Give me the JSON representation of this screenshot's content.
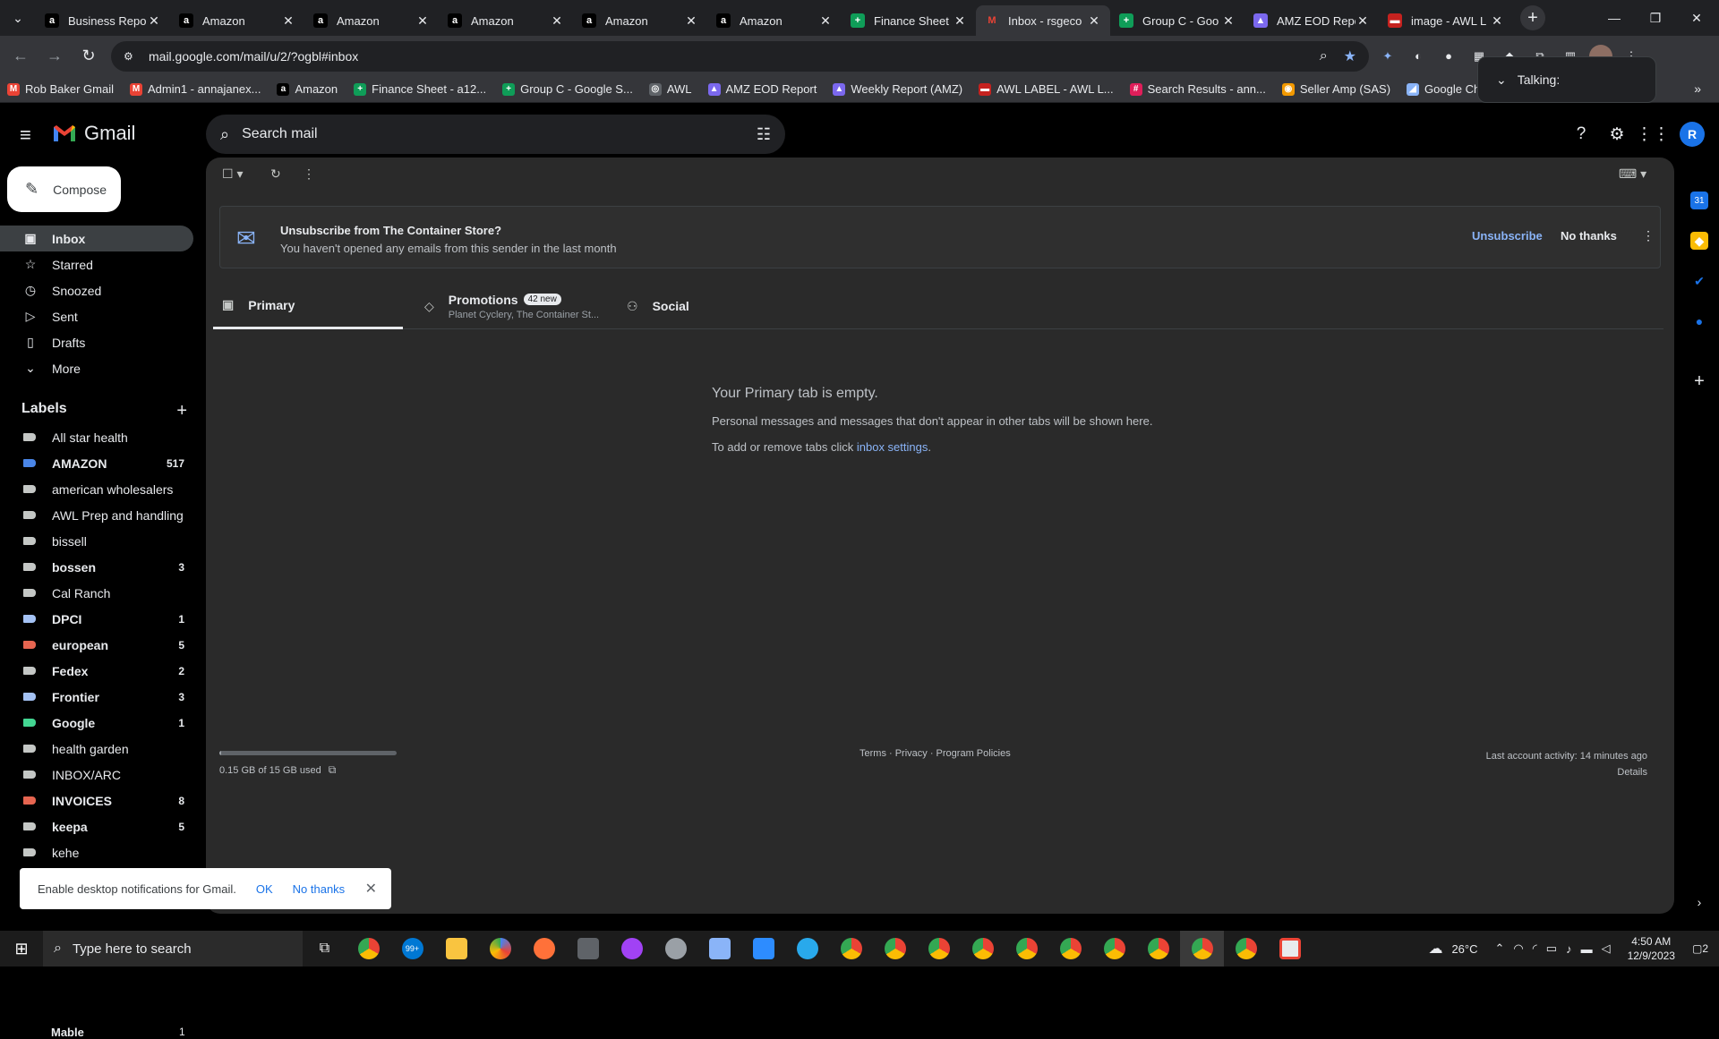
{
  "browser": {
    "tabs": [
      {
        "title": "Business Repor",
        "favicon": "amazon-icon",
        "fcolor": "#ffffff",
        "fbg": "#000000",
        "glyph": "a"
      },
      {
        "title": "Amazon",
        "favicon": "amazon-icon",
        "fcolor": "#ffffff",
        "fbg": "#000000",
        "glyph": "a"
      },
      {
        "title": "Amazon",
        "favicon": "amazon-icon",
        "fcolor": "#ffffff",
        "fbg": "#000000",
        "glyph": "a"
      },
      {
        "title": "Amazon",
        "favicon": "amazon-icon",
        "fcolor": "#ffffff",
        "fbg": "#000000",
        "glyph": "a"
      },
      {
        "title": "Amazon",
        "favicon": "amazon-icon",
        "fcolor": "#ffffff",
        "fbg": "#000000",
        "glyph": "a"
      },
      {
        "title": "Amazon",
        "favicon": "amazon-icon",
        "fcolor": "#ffffff",
        "fbg": "#000000",
        "glyph": "a"
      },
      {
        "title": "Finance Sheet",
        "favicon": "sheets-icon",
        "fcolor": "#ffffff",
        "fbg": "#0f9d58",
        "glyph": "+"
      },
      {
        "title": "Inbox - rsgeco",
        "favicon": "gmail-icon",
        "fcolor": "#ea4335",
        "fbg": "#35363a",
        "glyph": "M",
        "active": true
      },
      {
        "title": "Group C - Goo",
        "favicon": "sheets-icon",
        "fcolor": "#ffffff",
        "fbg": "#0f9d58",
        "glyph": "+"
      },
      {
        "title": "AMZ EOD Repo",
        "favicon": "clickup-icon",
        "fcolor": "#ffffff",
        "fbg": "#7b68ee",
        "glyph": "▲"
      },
      {
        "title": "image - AWL L",
        "favicon": "awl-label-icon",
        "fcolor": "#ffffff",
        "fbg": "#c5221f",
        "glyph": "▬"
      }
    ],
    "url": "mail.google.com/mail/u/2/?ogbl#inbox",
    "bookmarks": [
      {
        "label": "Rob Baker Gmail",
        "icon": "gmail-icon",
        "color": "#ea4335",
        "glyph": "M"
      },
      {
        "label": "Admin1 - annajanex...",
        "icon": "gmail-icon",
        "color": "#ea4335",
        "glyph": "M"
      },
      {
        "label": "Amazon",
        "icon": "amazon-icon",
        "color": "#000000",
        "glyph": "a"
      },
      {
        "label": "Finance Sheet - a12...",
        "icon": "sheets-icon",
        "color": "#0f9d58",
        "glyph": "+"
      },
      {
        "label": "Group C - Google S...",
        "icon": "sheets-icon",
        "color": "#0f9d58",
        "glyph": "+"
      },
      {
        "label": "AWL",
        "icon": "globe-icon",
        "color": "#5f6368",
        "glyph": "◎"
      },
      {
        "label": "AMZ EOD Report",
        "icon": "clickup-icon",
        "color": "#7b68ee",
        "glyph": "▲"
      },
      {
        "label": "Weekly Report (AMZ)",
        "icon": "clickup-icon",
        "color": "#7b68ee",
        "glyph": "▲"
      },
      {
        "label": "AWL LABEL - AWL L...",
        "icon": "awl-label-icon",
        "color": "#c5221f",
        "glyph": "▬"
      },
      {
        "label": "Search Results - ann...",
        "icon": "slack-icon",
        "color": "#e01e5a",
        "glyph": "#"
      },
      {
        "label": "Seller Amp (SAS)",
        "icon": "selleramp-icon",
        "color": "#f29900",
        "glyph": "◉"
      },
      {
        "label": "Google Chrome Ext...",
        "icon": "extension-icon",
        "color": "#8ab4f8",
        "glyph": "◢"
      }
    ],
    "talking": "Talking:"
  },
  "gmail": {
    "app_name": "Gmail",
    "search_placeholder": "Search mail",
    "avatar_letter": "R",
    "compose_label": "Compose",
    "nav": [
      {
        "label": "Inbox",
        "icon": "inbox-icon",
        "glyph": "▣",
        "active": true
      },
      {
        "label": "Starred",
        "icon": "star-icon",
        "glyph": "☆"
      },
      {
        "label": "Snoozed",
        "icon": "clock-icon",
        "glyph": "◷"
      },
      {
        "label": "Sent",
        "icon": "send-icon",
        "glyph": "▷"
      },
      {
        "label": "Drafts",
        "icon": "draft-icon",
        "glyph": "▯"
      },
      {
        "label": "More",
        "icon": "chevron-down-icon",
        "glyph": "⌄"
      }
    ],
    "labels_title": "Labels",
    "labels": [
      {
        "name": "All star health",
        "count": "",
        "color": "#c4c7c5"
      },
      {
        "name": "AMAZON",
        "count": "517",
        "color": "#4a86e8",
        "bold": true
      },
      {
        "name": "american wholesalers",
        "count": "",
        "color": "#c4c7c5"
      },
      {
        "name": "AWL Prep and handling",
        "count": "",
        "color": "#c4c7c5"
      },
      {
        "name": "bissell",
        "count": "",
        "color": "#c4c7c5"
      },
      {
        "name": "bossen",
        "count": "3",
        "color": "#c4c7c5",
        "bold": true
      },
      {
        "name": "Cal Ranch",
        "count": "",
        "color": "#c4c7c5"
      },
      {
        "name": "DPCI",
        "count": "1",
        "color": "#a4c2f4",
        "bold": true
      },
      {
        "name": "european",
        "count": "5",
        "color": "#e66550",
        "bold": true
      },
      {
        "name": "Fedex",
        "count": "2",
        "color": "#c4c7c5",
        "bold": true
      },
      {
        "name": "Frontier",
        "count": "3",
        "color": "#a4c2f4",
        "bold": true
      },
      {
        "name": "Google",
        "count": "1",
        "color": "#43d692",
        "bold": true
      },
      {
        "name": "health garden",
        "count": "",
        "color": "#c4c7c5"
      },
      {
        "name": "INBOX/ARC",
        "count": "",
        "color": "#c4c7c5"
      },
      {
        "name": "INVOICES",
        "count": "8",
        "color": "#e66550",
        "bold": true
      },
      {
        "name": "keepa",
        "count": "5",
        "color": "#c4c7c5",
        "bold": true
      },
      {
        "name": "kehe",
        "count": "",
        "color": "#c4c7c5"
      }
    ],
    "banner": {
      "title": "Unsubscribe from The Container Store?",
      "subtitle": "You haven't opened any emails from this sender in the last month",
      "unsubscribe": "Unsubscribe",
      "no_thanks": "No thanks"
    },
    "tabs": {
      "primary": "Primary",
      "promotions": "Promotions",
      "promotions_badge": "42 new",
      "promotions_senders": "Planet Cyclery, The Container St...",
      "social": "Social"
    },
    "empty": {
      "title": "Your Primary tab is empty.",
      "line1": "Personal messages and messages that don't appear in other tabs will be shown here.",
      "line2_prefix": "To add or remove tabs click ",
      "line2_link": "inbox settings",
      "line2_suffix": "."
    },
    "footer": {
      "storage": "0.15 GB of 15 GB used",
      "storage_fraction": 0.01,
      "links": "Terms · Privacy · Program Policies",
      "activity": "Last account activity: 14 minutes ago",
      "details": "Details"
    },
    "toast": {
      "message": "Enable desktop notifications for Gmail.",
      "ok": "OK",
      "no_thanks": "No thanks"
    },
    "partial_label": "Mable",
    "partial_count": "1"
  },
  "taskbar": {
    "search_placeholder": "Type here to search",
    "temperature": "26°C",
    "time": "4:50 AM",
    "date": "12/9/2023",
    "notif_count": "2",
    "mail_badge": "99+"
  }
}
